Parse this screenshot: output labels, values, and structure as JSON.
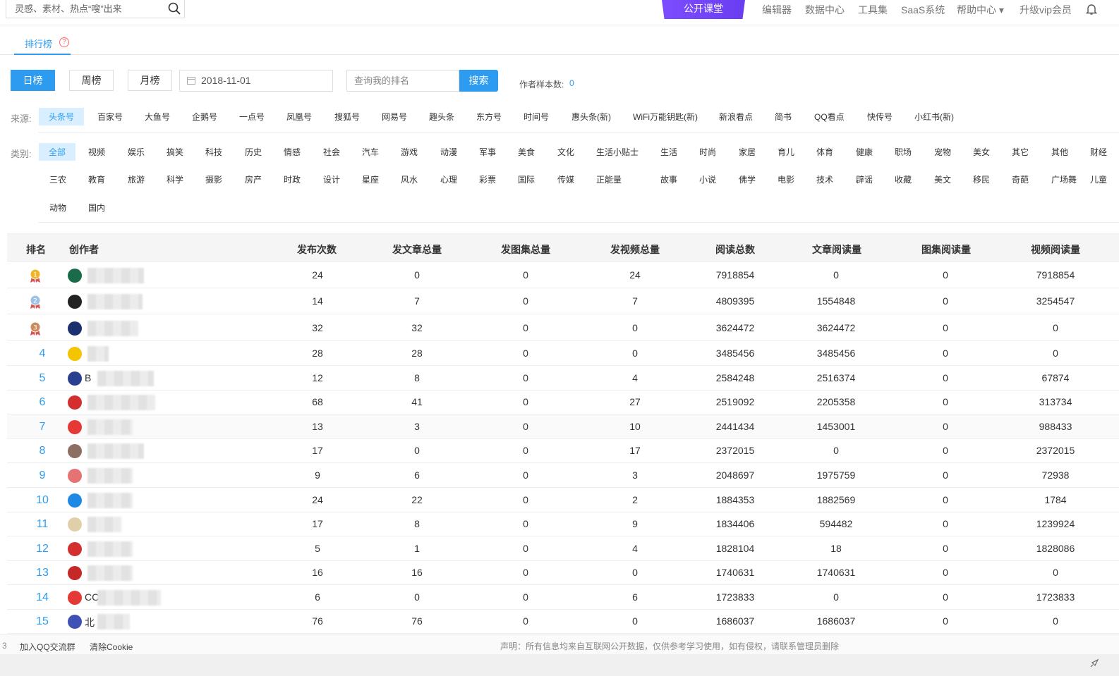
{
  "header": {
    "search_placeholder": "灵感、素材、热点“嗖”出来",
    "open_class": "公开课堂",
    "nav": [
      "编辑器",
      "数据中心",
      "工具集",
      "SaaS系统",
      "帮助中心 ▾",
      "升级vip会员"
    ]
  },
  "tabs": {
    "rank": "排行榜",
    "help": "?"
  },
  "period": {
    "daily": "日榜",
    "weekly": "周榜",
    "monthly": "月榜"
  },
  "date": "2018-11-01",
  "rank_search": {
    "placeholder": "查询我的排名",
    "button": "搜索"
  },
  "sample": {
    "label": "作者样本数:",
    "value": "0"
  },
  "source": {
    "label": "来源:",
    "items": [
      "头条号",
      "百家号",
      "大鱼号",
      "企鹅号",
      "一点号",
      "凤凰号",
      "搜狐号",
      "网易号",
      "趣头条",
      "东方号",
      "时间号",
      "惠头条(新)",
      "WiFi万能钥匙(新)",
      "新浪看点",
      "简书",
      "QQ看点",
      "快传号",
      "小红书(新)"
    ]
  },
  "category": {
    "label": "类别:",
    "row1": [
      "全部",
      "视频",
      "娱乐",
      "搞笑",
      "科技",
      "历史",
      "情感",
      "社会",
      "汽车",
      "游戏",
      "动漫",
      "军事",
      "美食",
      "文化",
      "生活小贴士",
      "生活",
      "时尚",
      "家居",
      "育儿",
      "体育",
      "健康",
      "职场",
      "宠物",
      "美女",
      "其它",
      "其他",
      "财经"
    ],
    "row2": [
      "三农",
      "教育",
      "旅游",
      "科学",
      "摄影",
      "房产",
      "时政",
      "设计",
      "星座",
      "风水",
      "心理",
      "彩票",
      "国际",
      "传媒",
      "正能量",
      "故事",
      "小说",
      "佛学",
      "电影",
      "技术",
      "辟谣",
      "收藏",
      "美文",
      "移民",
      "奇葩",
      "广场舞",
      "儿童"
    ],
    "row3": [
      "动物",
      "国内"
    ]
  },
  "table": {
    "headers": [
      "排名",
      "创作者",
      "发布次数",
      "发文章总量",
      "发图集总量",
      "发视频总量",
      "阅读总数",
      "文章阅读量",
      "图集阅读量",
      "视频阅读量"
    ],
    "rows": [
      {
        "rank": "1",
        "name": "",
        "c": [
          "24",
          "0",
          "0",
          "24",
          "7918854",
          "0",
          "0",
          "7918854"
        ]
      },
      {
        "rank": "2",
        "name": "",
        "c": [
          "14",
          "7",
          "0",
          "7",
          "4809395",
          "1554848",
          "0",
          "3254547"
        ]
      },
      {
        "rank": "3",
        "name": "",
        "c": [
          "32",
          "32",
          "0",
          "0",
          "3624472",
          "3624472",
          "0",
          "0"
        ]
      },
      {
        "rank": "4",
        "name": "",
        "c": [
          "28",
          "28",
          "0",
          "0",
          "3485456",
          "3485456",
          "0",
          "0"
        ]
      },
      {
        "rank": "5",
        "name": "B",
        "c": [
          "12",
          "8",
          "0",
          "4",
          "2584248",
          "2516374",
          "0",
          "67874"
        ]
      },
      {
        "rank": "6",
        "name": "",
        "c": [
          "68",
          "41",
          "0",
          "27",
          "2519092",
          "2205358",
          "0",
          "313734"
        ]
      },
      {
        "rank": "7",
        "name": "",
        "c": [
          "13",
          "3",
          "0",
          "10",
          "2441434",
          "1453001",
          "0",
          "988433"
        ]
      },
      {
        "rank": "8",
        "name": "",
        "c": [
          "17",
          "0",
          "0",
          "17",
          "2372015",
          "0",
          "0",
          "2372015"
        ]
      },
      {
        "rank": "9",
        "name": "",
        "c": [
          "9",
          "6",
          "0",
          "3",
          "2048697",
          "1975759",
          "0",
          "72938"
        ]
      },
      {
        "rank": "10",
        "name": "",
        "c": [
          "24",
          "22",
          "0",
          "2",
          "1884353",
          "1882569",
          "0",
          "1784"
        ]
      },
      {
        "rank": "11",
        "name": "",
        "c": [
          "17",
          "8",
          "0",
          "9",
          "1834406",
          "594482",
          "0",
          "1239924"
        ]
      },
      {
        "rank": "12",
        "name": "",
        "c": [
          "5",
          "1",
          "0",
          "4",
          "1828104",
          "18",
          "0",
          "1828086"
        ]
      },
      {
        "rank": "13",
        "name": "",
        "c": [
          "16",
          "16",
          "0",
          "0",
          "1740631",
          "1740631",
          "0",
          "0"
        ]
      },
      {
        "rank": "14",
        "name": "CC",
        "c": [
          "6",
          "0",
          "0",
          "6",
          "1723833",
          "0",
          "0",
          "1723833"
        ]
      },
      {
        "rank": "15",
        "name": "北",
        "c": [
          "76",
          "76",
          "0",
          "0",
          "1686037",
          "1686037",
          "0",
          "0"
        ]
      }
    ]
  },
  "footer": {
    "num": "3",
    "qq": "加入QQ交流群",
    "cookie": "清除Cookie",
    "note": "声明：所有信息均来自互联网公开数据，仅供参考学习使用，如有侵权，请联系管理员删除"
  },
  "colors": {
    "accent": "#2d9cf0",
    "promo": "#7c4dff"
  }
}
